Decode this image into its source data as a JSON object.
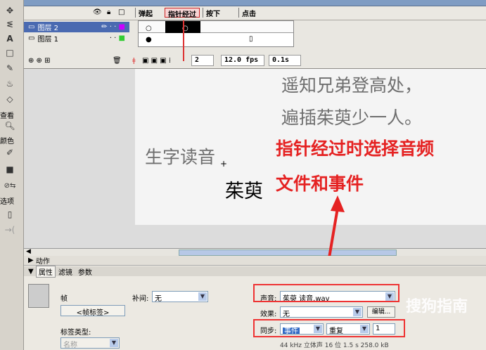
{
  "timeline": {
    "layers": [
      {
        "name": "图层 2",
        "selected": true
      },
      {
        "name": "图层 1",
        "selected": false
      }
    ],
    "frame_labels": [
      "弹起",
      "指针经过",
      "按下",
      "点击"
    ],
    "current_frame": "2",
    "frame_rate": "12.0 fps",
    "elapsed": "0.1s"
  },
  "tools": {
    "view_label": "查看",
    "color_label": "颜色",
    "options_label": "选项"
  },
  "stage": {
    "poem_line1": "遥知兄弟登高处，",
    "poem_line2": "遍插茱萸少一人。",
    "heading": "生字读音",
    "word": "茱萸",
    "annotation_line1": "指针经过时选择音频",
    "annotation_line2": "文件和事件"
  },
  "panel": {
    "actions_label": "动作",
    "tabs": [
      "属性",
      "滤镜",
      "参数"
    ],
    "frame_label": "帧",
    "frame_name_placeholder": "<帧标签>",
    "label_type_label": "标签类型:",
    "label_type_value": "名称",
    "tween_label": "补间:",
    "tween_value": "无",
    "sound_label": "声音:",
    "sound_value": "茱萸 读音.wav",
    "effect_label": "效果:",
    "effect_value": "无",
    "edit_button": "编辑...",
    "sync_label": "同步:",
    "sync_value": "事件",
    "repeat_value": "重复",
    "repeat_count": "1",
    "sound_info": "44 kHz 立体声 16 位 1.5 s 258.0 kB"
  },
  "watermark": "搜狗指南",
  "colors": {
    "accent_red": "#e52222",
    "selection_blue": "#4a6ab1"
  }
}
